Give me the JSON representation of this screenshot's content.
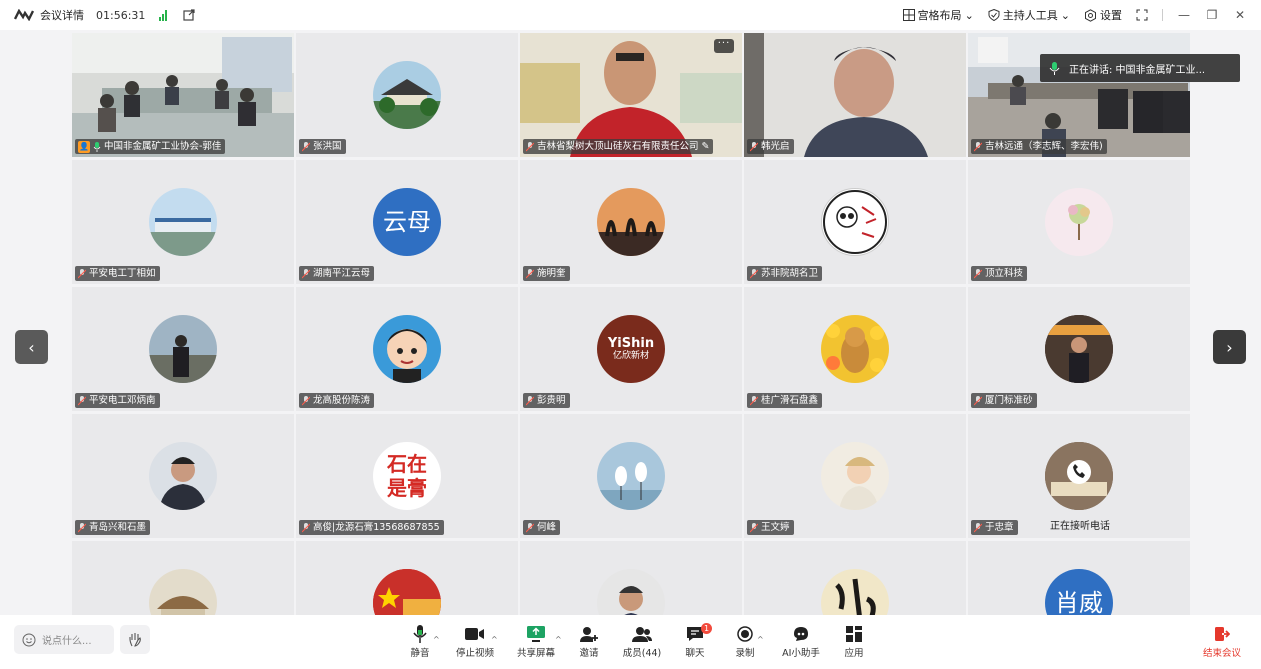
{
  "titlebar": {
    "meeting_details": "会议详情",
    "timer": "01:56:31",
    "layout_label": "宫格布局",
    "host_tools_label": "主持人工具",
    "settings_label": "设置"
  },
  "speaking_banner": {
    "text": "正在讲话:  中国非金属矿工业..."
  },
  "tiles": [
    {
      "name": "中国非金属矿工业协会-郭佳",
      "kind": "video",
      "active": true,
      "host": true
    },
    {
      "name": "张洪国",
      "kind": "avatar"
    },
    {
      "name": "吉林省梨树大顶山硅灰石有限责任公司",
      "kind": "video",
      "more": true,
      "pen": true
    },
    {
      "name": "韩光启",
      "kind": "video"
    },
    {
      "name": "吉林远通（李志辉、李宏伟)",
      "kind": "video"
    },
    {
      "name": "平安电工丁相如",
      "kind": "avatar"
    },
    {
      "name": "湖南平江云母",
      "kind": "avatar",
      "avatar_text": "云母"
    },
    {
      "name": "施明奎",
      "kind": "avatar"
    },
    {
      "name": "苏非院胡名卫",
      "kind": "avatar"
    },
    {
      "name": "顶立科技",
      "kind": "avatar"
    },
    {
      "name": "平安电工邓炳南",
      "kind": "avatar"
    },
    {
      "name": "龙高股份陈涛",
      "kind": "avatar"
    },
    {
      "name": "彭贵明",
      "kind": "avatar",
      "avatar_text": "YiShin",
      "avatar_sub": "亿欣新材"
    },
    {
      "name": "桂广滑石盘鑫",
      "kind": "avatar"
    },
    {
      "name": "厦门标准砂",
      "kind": "avatar"
    },
    {
      "name": "青岛兴和石墨",
      "kind": "avatar"
    },
    {
      "name": "高俊|龙源石膏13568687855",
      "kind": "avatar",
      "avatar_text": "石在 是膏"
    },
    {
      "name": "何峰",
      "kind": "avatar"
    },
    {
      "name": "王文婷",
      "kind": "avatar"
    },
    {
      "name": "于忠章",
      "kind": "avatar",
      "status": "正在接听电话"
    },
    {
      "name": "",
      "kind": "avatar"
    },
    {
      "name": "",
      "kind": "avatar"
    },
    {
      "name": "",
      "kind": "avatar"
    },
    {
      "name": "",
      "kind": "avatar"
    },
    {
      "name": "",
      "kind": "avatar",
      "avatar_text": "肖威"
    }
  ],
  "toolbar": {
    "chat_placeholder": "说点什么...",
    "mute": "静音",
    "stop_video": "停止视频",
    "share_screen": "共享屏幕",
    "invite": "邀请",
    "members": "成员(44)",
    "chat": "聊天",
    "chat_badge": "1",
    "record": "录制",
    "ai_assistant": "AI小助手",
    "apps": "应用",
    "end_meeting": "结束会议"
  },
  "colors": {
    "accent_green": "#27b34b",
    "active_border": "#4cd07a",
    "end_red": "#e5382c",
    "badge_red": "#f24b3d"
  }
}
